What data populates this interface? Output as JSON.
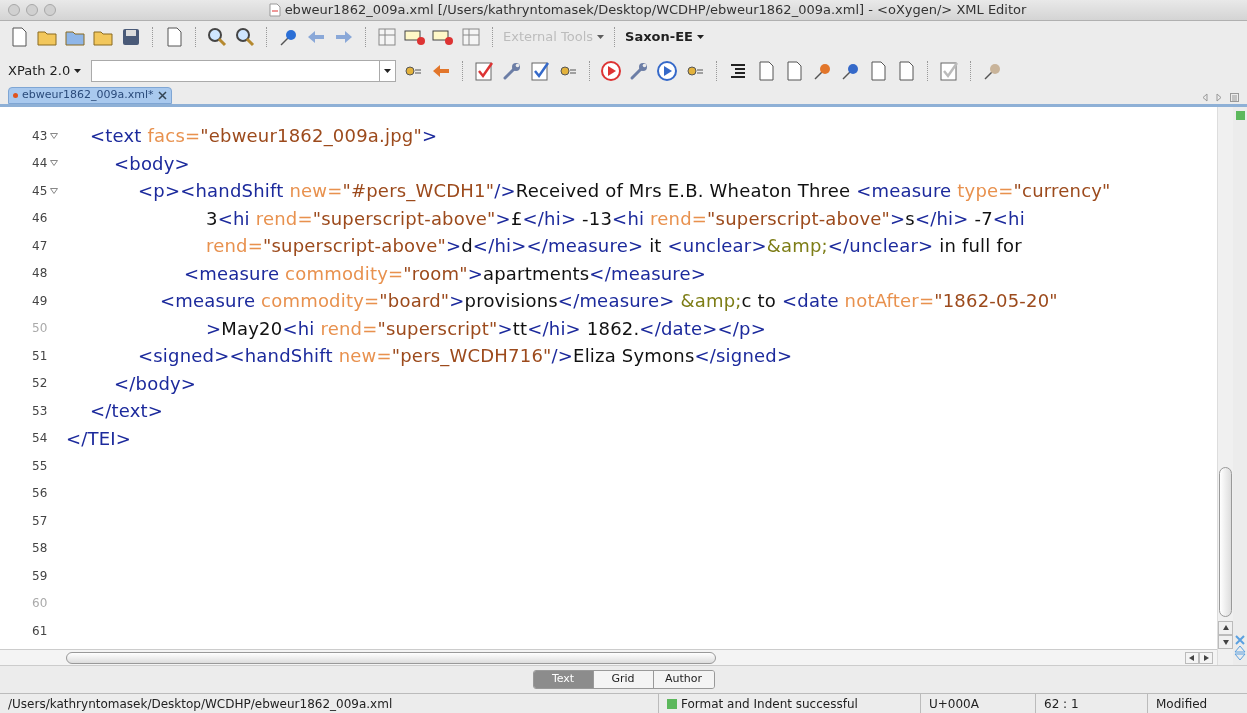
{
  "window": {
    "title": "ebweur1862_009a.xml [/Users/kathryntomasek/Desktop/WCDHP/ebweur1862_009a.xml] - <oXygen/> XML Editor"
  },
  "toolbar": {
    "external_tools": {
      "label": "External Tools",
      "disabled": true
    },
    "engine": {
      "label": "Saxon-EE",
      "disabled": false
    }
  },
  "xpath": {
    "version": "XPath 2.0"
  },
  "editor_tabs": [
    {
      "label": "ebweur1862_009a.xml*",
      "selected": true,
      "modified": true
    }
  ],
  "lines": [
    {
      "number": "43",
      "foldable": true,
      "dimmed": false,
      "tokens": [
        {
          "kind": "tag",
          "text": "<text "
        },
        {
          "kind": "attr",
          "text": "facs="
        },
        {
          "kind": "value",
          "text": "\"ebweur1862_009a.jpg\""
        },
        {
          "kind": "tag",
          "text": ">"
        }
      ]
    },
    {
      "number": "44",
      "foldable": true,
      "dimmed": false,
      "tokens": [
        {
          "kind": "tag",
          "text": "<body>"
        }
      ]
    },
    {
      "number": "45",
      "foldable": true,
      "dimmed": false,
      "tokens": [
        {
          "kind": "tag",
          "text": "<p><handShift "
        },
        {
          "kind": "attr",
          "text": "new="
        },
        {
          "kind": "value",
          "text": "\"#pers_WCDH1\""
        },
        {
          "kind": "tag",
          "text": "/>"
        },
        {
          "kind": "text",
          "text": "Received of Mrs E.B. Wheaton Three "
        },
        {
          "kind": "tag",
          "text": "<measure "
        },
        {
          "kind": "attr",
          "text": "type="
        },
        {
          "kind": "value",
          "text": "\"currency\""
        }
      ]
    },
    {
      "number": "46",
      "foldable": false,
      "dimmed": false,
      "tokens": [
        {
          "kind": "text",
          "text": "3"
        },
        {
          "kind": "tag",
          "text": "<hi "
        },
        {
          "kind": "attr",
          "text": "rend="
        },
        {
          "kind": "value",
          "text": "\"superscript-above\""
        },
        {
          "kind": "tag",
          "text": ">"
        },
        {
          "kind": "text",
          "text": "£"
        },
        {
          "kind": "tag",
          "text": "</hi>"
        },
        {
          "kind": "text",
          "text": " -13"
        },
        {
          "kind": "tag",
          "text": "<hi "
        },
        {
          "kind": "attr",
          "text": "rend="
        },
        {
          "kind": "value",
          "text": "\"superscript-above\""
        },
        {
          "kind": "tag",
          "text": ">"
        },
        {
          "kind": "text",
          "text": "s"
        },
        {
          "kind": "tag",
          "text": "</hi>"
        },
        {
          "kind": "text",
          "text": " -7"
        },
        {
          "kind": "tag",
          "text": "<hi"
        }
      ]
    },
    {
      "number": "47",
      "foldable": false,
      "dimmed": false,
      "tokens": [
        {
          "kind": "attr",
          "text": "rend="
        },
        {
          "kind": "value",
          "text": "\"superscript-above\""
        },
        {
          "kind": "tag",
          "text": ">"
        },
        {
          "kind": "text",
          "text": "d"
        },
        {
          "kind": "tag",
          "text": "</hi></measure>"
        },
        {
          "kind": "text",
          "text": " it "
        },
        {
          "kind": "tag",
          "text": "<unclear>"
        },
        {
          "kind": "entity",
          "text": "&amp;"
        },
        {
          "kind": "tag",
          "text": "</unclear>"
        },
        {
          "kind": "text",
          "text": " in full for"
        }
      ]
    },
    {
      "number": "48",
      "foldable": false,
      "dimmed": false,
      "tokens": [
        {
          "kind": "tag",
          "text": "<measure "
        },
        {
          "kind": "attr",
          "text": "commodity="
        },
        {
          "kind": "value",
          "text": "\"room\""
        },
        {
          "kind": "tag",
          "text": ">"
        },
        {
          "kind": "text",
          "text": "apartments"
        },
        {
          "kind": "tag",
          "text": "</measure>"
        }
      ]
    },
    {
      "number": "49",
      "foldable": false,
      "dimmed": false,
      "tokens": [
        {
          "kind": "tag",
          "text": "<measure "
        },
        {
          "kind": "attr",
          "text": "commodity="
        },
        {
          "kind": "value",
          "text": "\"board\""
        },
        {
          "kind": "tag",
          "text": ">"
        },
        {
          "kind": "text",
          "text": "provisions"
        },
        {
          "kind": "tag",
          "text": "</measure>"
        },
        {
          "kind": "entity",
          "text": " &amp;"
        },
        {
          "kind": "text",
          "text": "c to "
        },
        {
          "kind": "tag",
          "text": "<date "
        },
        {
          "kind": "attr",
          "text": "notAfter="
        },
        {
          "kind": "value",
          "text": "\"1862-05-20\""
        }
      ]
    },
    {
      "number": "50",
      "foldable": false,
      "dimmed": true,
      "tokens": [
        {
          "kind": "tag",
          "text": ">"
        },
        {
          "kind": "text",
          "text": "May20"
        },
        {
          "kind": "tag",
          "text": "<hi "
        },
        {
          "kind": "attr",
          "text": "rend="
        },
        {
          "kind": "value",
          "text": "\"superscript\""
        },
        {
          "kind": "tag",
          "text": ">"
        },
        {
          "kind": "text",
          "text": "tt"
        },
        {
          "kind": "tag",
          "text": "</hi>"
        },
        {
          "kind": "text",
          "text": " 1862."
        },
        {
          "kind": "tag",
          "text": "</date></p>"
        }
      ]
    },
    {
      "number": "51",
      "foldable": false,
      "dimmed": false,
      "tokens": [
        {
          "kind": "tag",
          "text": "<signed><handShift "
        },
        {
          "kind": "attr",
          "text": "new="
        },
        {
          "kind": "value",
          "text": "\"pers_WCDH716\""
        },
        {
          "kind": "tag",
          "text": "/>"
        },
        {
          "kind": "text",
          "text": "Eliza Symons"
        },
        {
          "kind": "tag",
          "text": "</signed>"
        }
      ]
    },
    {
      "number": "52",
      "foldable": false,
      "dimmed": false,
      "tokens": [
        {
          "kind": "tag",
          "text": "</body>"
        }
      ]
    },
    {
      "number": "53",
      "foldable": false,
      "dimmed": false,
      "tokens": [
        {
          "kind": "tag",
          "text": "</text>"
        }
      ]
    },
    {
      "number": "54",
      "foldable": false,
      "dimmed": false,
      "tokens": [
        {
          "kind": "tag",
          "text": "</TEI>"
        }
      ]
    },
    {
      "number": "55",
      "foldable": false,
      "dimmed": false
    },
    {
      "number": "56",
      "foldable": false,
      "dimmed": false
    },
    {
      "number": "57",
      "foldable": false,
      "dimmed": false
    },
    {
      "number": "58",
      "foldable": false,
      "dimmed": false
    },
    {
      "number": "59",
      "foldable": false,
      "dimmed": false
    },
    {
      "number": "60",
      "foldable": false,
      "dimmed": true
    },
    {
      "number": "61",
      "foldable": false,
      "dimmed": false
    }
  ],
  "view_modes": [
    {
      "label": "Text",
      "selected": true
    },
    {
      "label": "Grid",
      "selected": false
    },
    {
      "label": "Author",
      "selected": false
    }
  ],
  "status_bar": {
    "path": "/Users/kathryntomasek/Desktop/WCDHP/ebweur1862_009a.xml",
    "message": "Format and Indent successful",
    "unicode": "U+000A",
    "position": "62 : 1",
    "state": "Modified"
  }
}
